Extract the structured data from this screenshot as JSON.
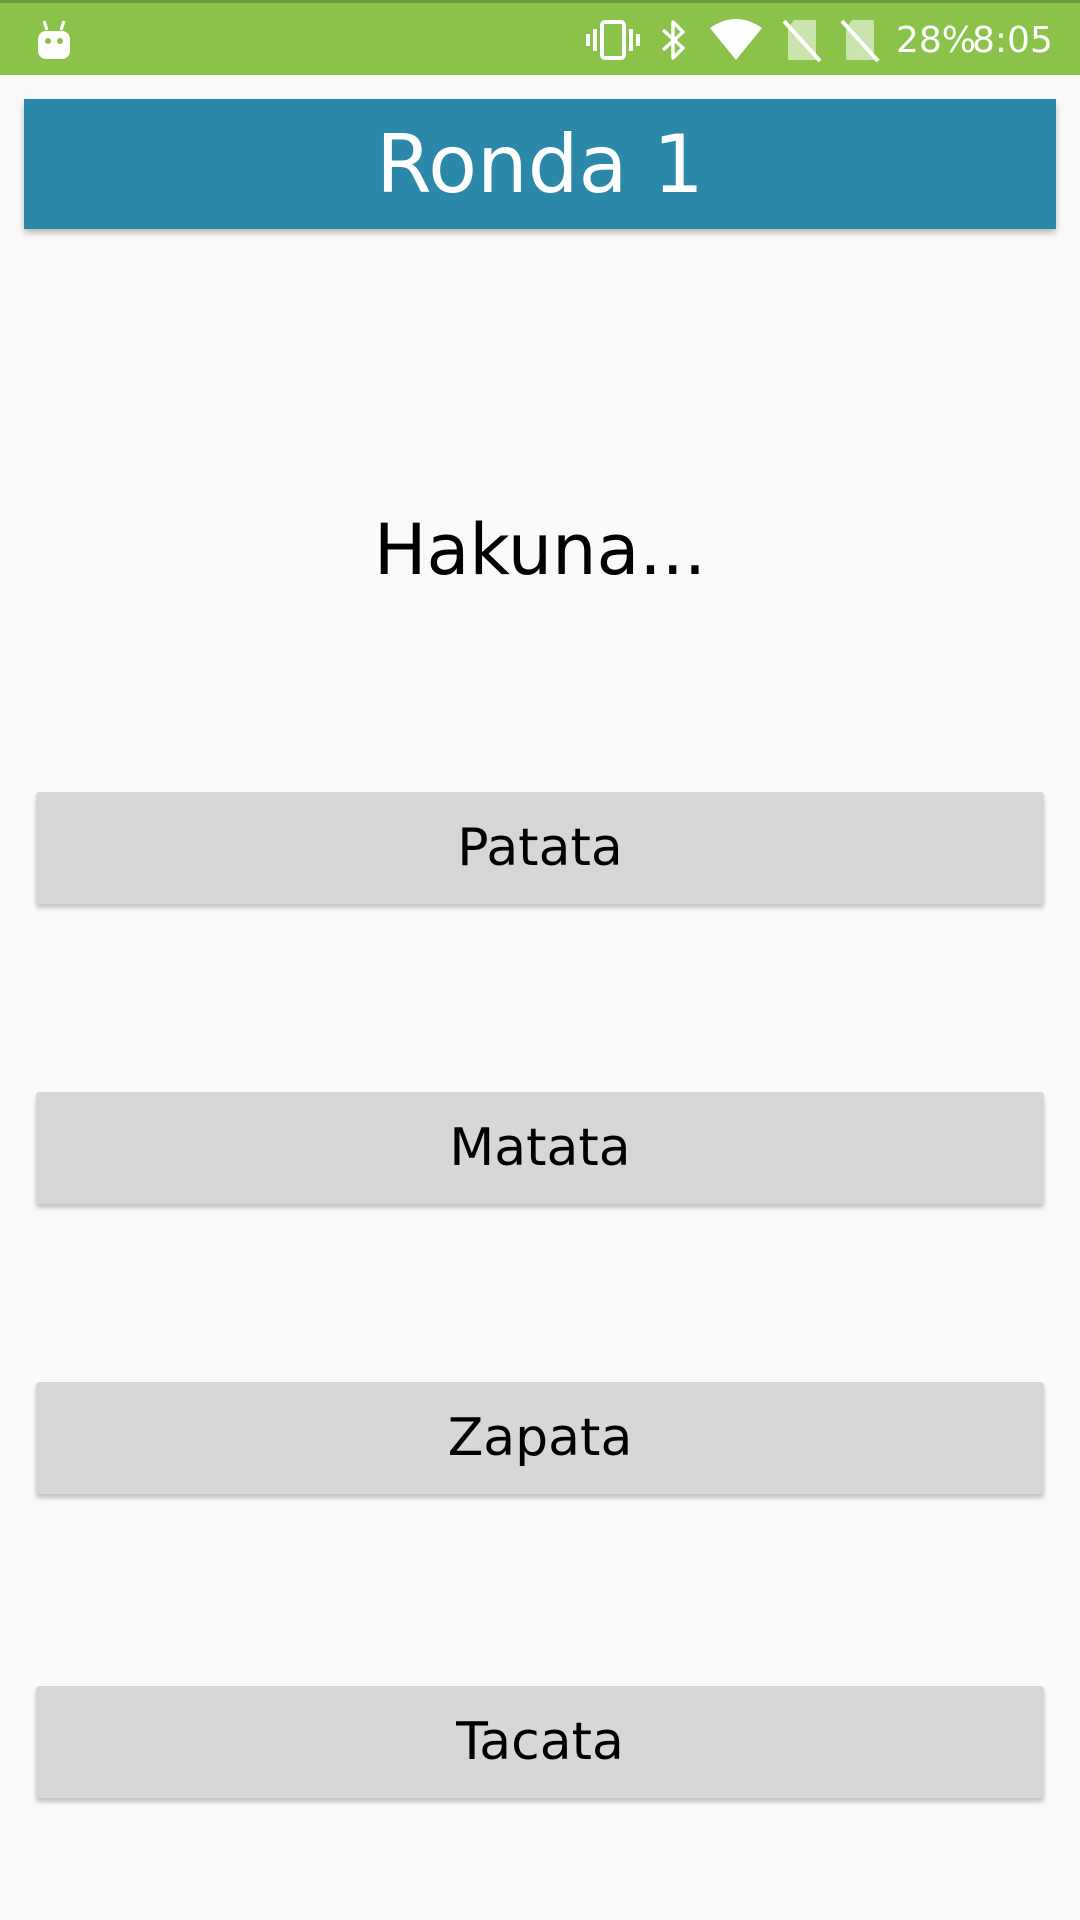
{
  "status_bar": {
    "battery": "28%",
    "time": "8:05",
    "icons": [
      "android-icon",
      "vibrate-icon",
      "bluetooth-icon",
      "wifi-icon",
      "no-sim-icon",
      "no-sim-icon"
    ]
  },
  "header": {
    "title": "Ronda 1"
  },
  "question": {
    "text": "Hakuna..."
  },
  "answers": [
    {
      "label": "Patata"
    },
    {
      "label": "Matata"
    },
    {
      "label": "Zapata"
    },
    {
      "label": "Tacata"
    }
  ],
  "colors": {
    "status_bar": "#8bc34a",
    "header": "#2b88a8",
    "background": "#fafafa",
    "button": "#d6d7d7"
  }
}
